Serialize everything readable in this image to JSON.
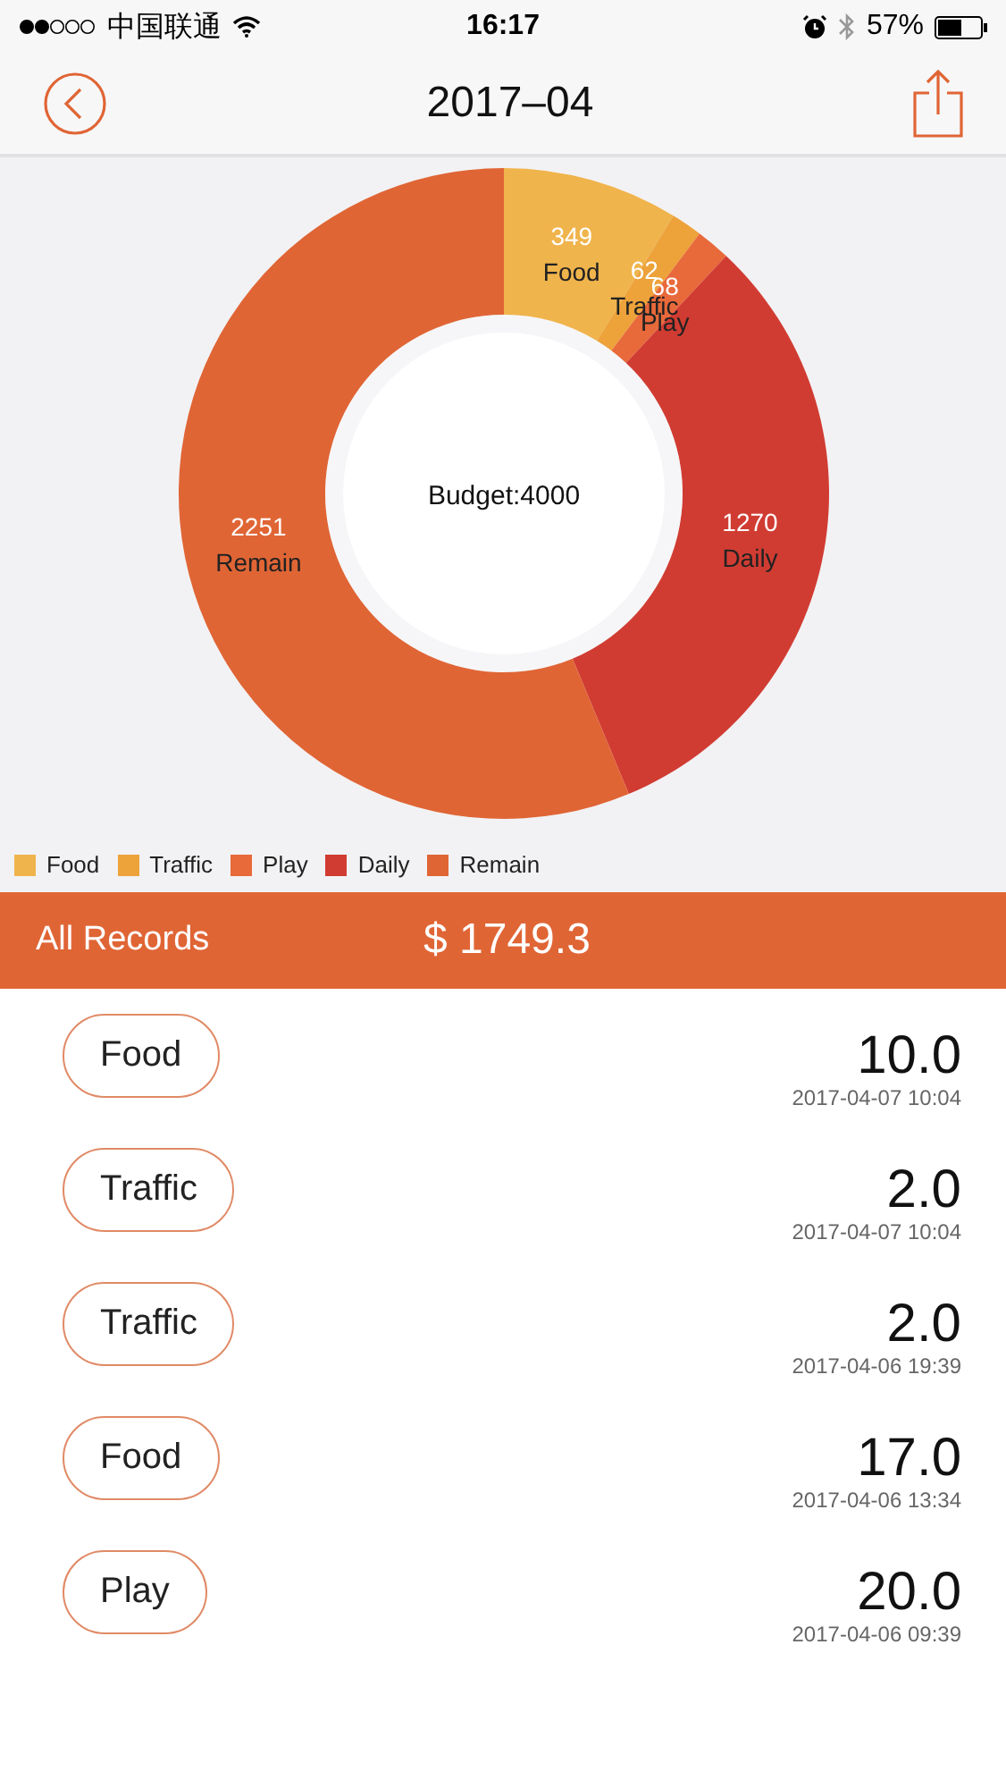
{
  "status_bar": {
    "carrier": "中国联通",
    "time": "16:17",
    "battery": "57%"
  },
  "nav": {
    "title": "2017–04"
  },
  "chart": {
    "center_label": "Budget:4000",
    "chart_data": {
      "type": "donut",
      "categories": [
        "Food",
        "Traffic",
        "Play",
        "Daily",
        "Remain"
      ],
      "data_labels": true,
      "values": [
        349,
        62,
        68,
        1270,
        2251
      ],
      "colors": [
        "#f0b44c",
        "#eda23a",
        "#e8693a",
        "#d13c32",
        "#e06535"
      ]
    }
  },
  "summary": {
    "label": "All Records",
    "total": "$ 1749.3"
  },
  "records": [
    {
      "category": "Food",
      "amount": "10.0",
      "date": "2017-04-07 10:04"
    },
    {
      "category": "Traffic",
      "amount": "2.0",
      "date": "2017-04-07 10:04"
    },
    {
      "category": "Traffic",
      "amount": "2.0",
      "date": "2017-04-06 19:39"
    },
    {
      "category": "Food",
      "amount": "17.0",
      "date": "2017-04-06 13:34"
    },
    {
      "category": "Play",
      "amount": "20.0",
      "date": "2017-04-06 09:39"
    }
  ]
}
